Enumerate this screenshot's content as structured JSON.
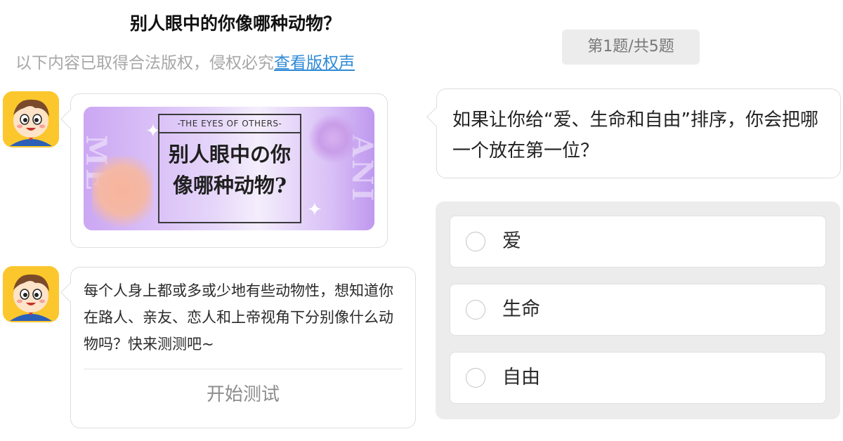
{
  "header": {
    "title": "别人眼中的你像哪种动物？",
    "copyright_notice": "以下内容已取得合法版权，侵权必究",
    "copyright_link": "查看版权声"
  },
  "progress": {
    "label": "第1题/共5题",
    "current": 1,
    "total": 5
  },
  "cover": {
    "tag": "-THE EYES OF OTHERS-",
    "line1": "别人眼中の你",
    "line2": "像哪种动物?",
    "side_left": "ME",
    "side_right": "ANI"
  },
  "intro": {
    "text": "每个人身上都或多或少地有些动物性，想知道你在路人、亲友、恋人和上帝视角下分别像什么动物吗？快来测测吧~",
    "start_label": "开始测试"
  },
  "question": {
    "text": "如果让你给“爱、生命和自由”排序，你会把哪一个放在第一位？"
  },
  "options": [
    {
      "label": "爱"
    },
    {
      "label": "生命"
    },
    {
      "label": "自由"
    }
  ],
  "colors": {
    "link": "#2f8ad6",
    "avatar_bg": "#fbc72c",
    "panel_bg": "#ececec"
  },
  "icons": {
    "avatar": "cartoon-boy-avatar",
    "radio": "radio-unchecked-icon"
  }
}
